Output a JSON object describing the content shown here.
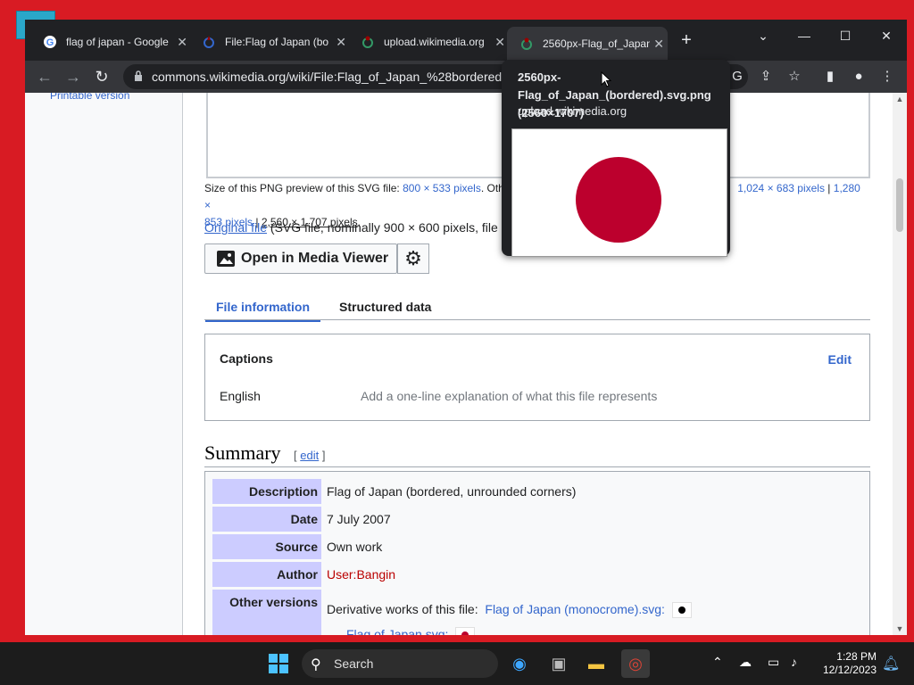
{
  "browser": {
    "tabs": [
      {
        "title": "flag of japan - Google",
        "close": "✕"
      },
      {
        "title": "File:Flag of Japan (bo",
        "close": "✕"
      },
      {
        "title": "upload.wikimedia.org",
        "close": "✕"
      },
      {
        "title": "2560px-Flag_of_Japan",
        "close": "✕"
      }
    ],
    "new_tab": "+",
    "url": "commons.wikimedia.org/wiki/File:Flag_of_Japan_%28bordered%",
    "hover_card": {
      "title": "2560px-Flag_of_Japan_(bordered).svg.png (2560×1707)",
      "host": "upload.wikimedia.org"
    }
  },
  "page": {
    "sidebar_link": "Printable version",
    "size_prefix": "Size of this PNG preview of this SVG file:",
    "size_800": "800 × 533 pixels",
    "size_other": ". Othe",
    "size_1024": "1,024 × 683 pixels",
    "size_sep1": "|",
    "size_1280": "1,280 ×",
    "size_853": "853 pixels",
    "size_sep2": "|",
    "size_2560": "2,560 × 1,707 pixels",
    "size_end": ".",
    "original_link": "Original file",
    "original_rest": "(SVG file, nominally 900 × 600 pixels, file",
    "media_viewer": "Open in Media Viewer",
    "tabs": [
      {
        "label": "File information"
      },
      {
        "label": "Structured data"
      }
    ],
    "captions": {
      "heading": "Captions",
      "edit": "Edit",
      "language": "English",
      "placeholder": "Add a one-line explanation of what this file represents"
    },
    "summary": {
      "heading": "Summary",
      "edit_open": "[",
      "edit": "edit",
      "edit_close": "]",
      "rows": [
        {
          "key": "Description",
          "value": "Flag of Japan (bordered, unrounded corners)"
        },
        {
          "key": "Date",
          "value": "7 July 2007"
        },
        {
          "key": "Source",
          "value": "Own work"
        },
        {
          "key": "Author",
          "value": "User:Bangin"
        },
        {
          "key": "Other versions",
          "value": "Derivative works of this file:"
        }
      ],
      "other_link1": "Flag of Japan (monocrome).svg",
      "other_colon": ":",
      "other_link2": "Flag of Japan.svg:"
    }
  },
  "taskbar": {
    "search": "Search",
    "time": "1:28 PM",
    "date": "12/12/2023"
  },
  "colors": {
    "flag_red": "#bc002d",
    "link_blue": "#3366cc",
    "desktop_red": "#d81b23"
  }
}
